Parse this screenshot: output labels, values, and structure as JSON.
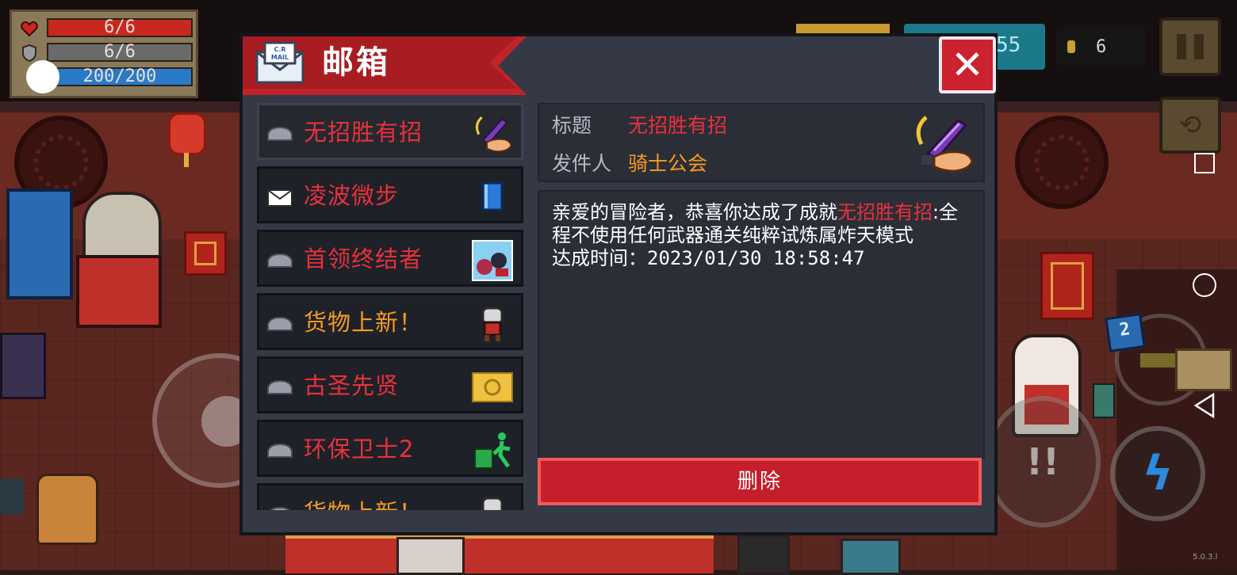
{
  "hud": {
    "hp": "6/6",
    "armor": "6/6",
    "energy": "200/200",
    "gems": "55",
    "coins": "6",
    "weapon_level": "2",
    "version": "5.0.3.l",
    "attack_glyph": "!!",
    "skill_glyph": "ϟ",
    "swap_glyph": "⟲"
  },
  "mailbox": {
    "title": "邮箱",
    "close_glyph": "✕",
    "mail_icon_text": "C.R MAIL",
    "items": [
      {
        "label": "无招胜有招",
        "color": "#e8313b",
        "read": true,
        "thumb": "sword-hand-icon"
      },
      {
        "label": "凌波微步",
        "color": "#e8313b",
        "read": false,
        "thumb": "blue-book-icon"
      },
      {
        "label": "首领终结者",
        "color": "#e8313b",
        "read": true,
        "thumb": "boss-portrait-icon"
      },
      {
        "label": "货物上新！",
        "color": "#f59a23",
        "read": true,
        "thumb": "merchant-icon"
      },
      {
        "label": "古圣先贤",
        "color": "#e8313b",
        "read": true,
        "thumb": "gold-plaque-icon"
      },
      {
        "label": "环保卫士2",
        "color": "#e8313b",
        "read": true,
        "thumb": "recycle-bin-icon"
      },
      {
        "label": "货物上新！",
        "color": "#f59a23",
        "read": true,
        "thumb": "merchant-icon"
      }
    ],
    "detail": {
      "subject_label": "标题",
      "subject": "无招胜有招",
      "sender_label": "发件人",
      "sender": "骑士公会",
      "body_intro": "亲爱的冒险者，恭喜你达成了成就",
      "body_highlight": "无招胜有招",
      "body_rest": ":全程不使用任何武器通关纯粹试炼属炸天模式",
      "achieved_label": "达成时间：",
      "achieved_time": "2023/01/30 18:58:47",
      "thumb": "sword-hand-icon"
    },
    "delete_label": "删除"
  },
  "colors": {
    "accent_red": "#e8313b",
    "orange": "#f59a23",
    "panel_bg": "#353945",
    "title_banner": "#c0242a",
    "delete_button": "#c61e2a"
  }
}
